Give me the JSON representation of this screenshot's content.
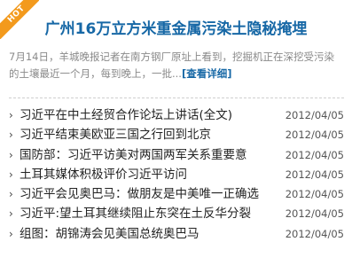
{
  "badge": {
    "label": "HOT"
  },
  "headline": {
    "title": "广州16万立方米重金属污染土隐秘掩埋"
  },
  "summary": {
    "line1": "7月14日，羊城晚报记者在南方钢厂原址上看到，挖掘机正在深挖受污染",
    "line2": "的土壤最近一个月，每到晚上，一批...",
    "more_label": "[查看详细]"
  },
  "news": {
    "bullet": "›",
    "items": [
      {
        "title": "习近平在中土经贸合作论坛上讲话(全文)",
        "date": "2012/04/05"
      },
      {
        "title": "习近平结束美欧亚三国之行回到北京",
        "date": "2012/04/05"
      },
      {
        "title": "国防部：习近平访美对两国两军关系重要意",
        "date": "2012/04/05"
      },
      {
        "title": "土耳其媒体积极评价习近平访问",
        "date": "2012/04/05"
      },
      {
        "title": "习近平会见奥巴马：做朋友是中美唯一正确选",
        "date": "2012/04/05"
      },
      {
        "title": "习近平:望土耳其继续阻止东突在土反华分裂",
        "date": "2012/04/05"
      },
      {
        "title": "组图：胡锦涛会见美国总统奥巴马",
        "date": "2012/04/05"
      }
    ]
  },
  "colors": {
    "headline": "#1768a6",
    "badge": "#f39a1d",
    "summary_text": "#8a8a8a"
  }
}
